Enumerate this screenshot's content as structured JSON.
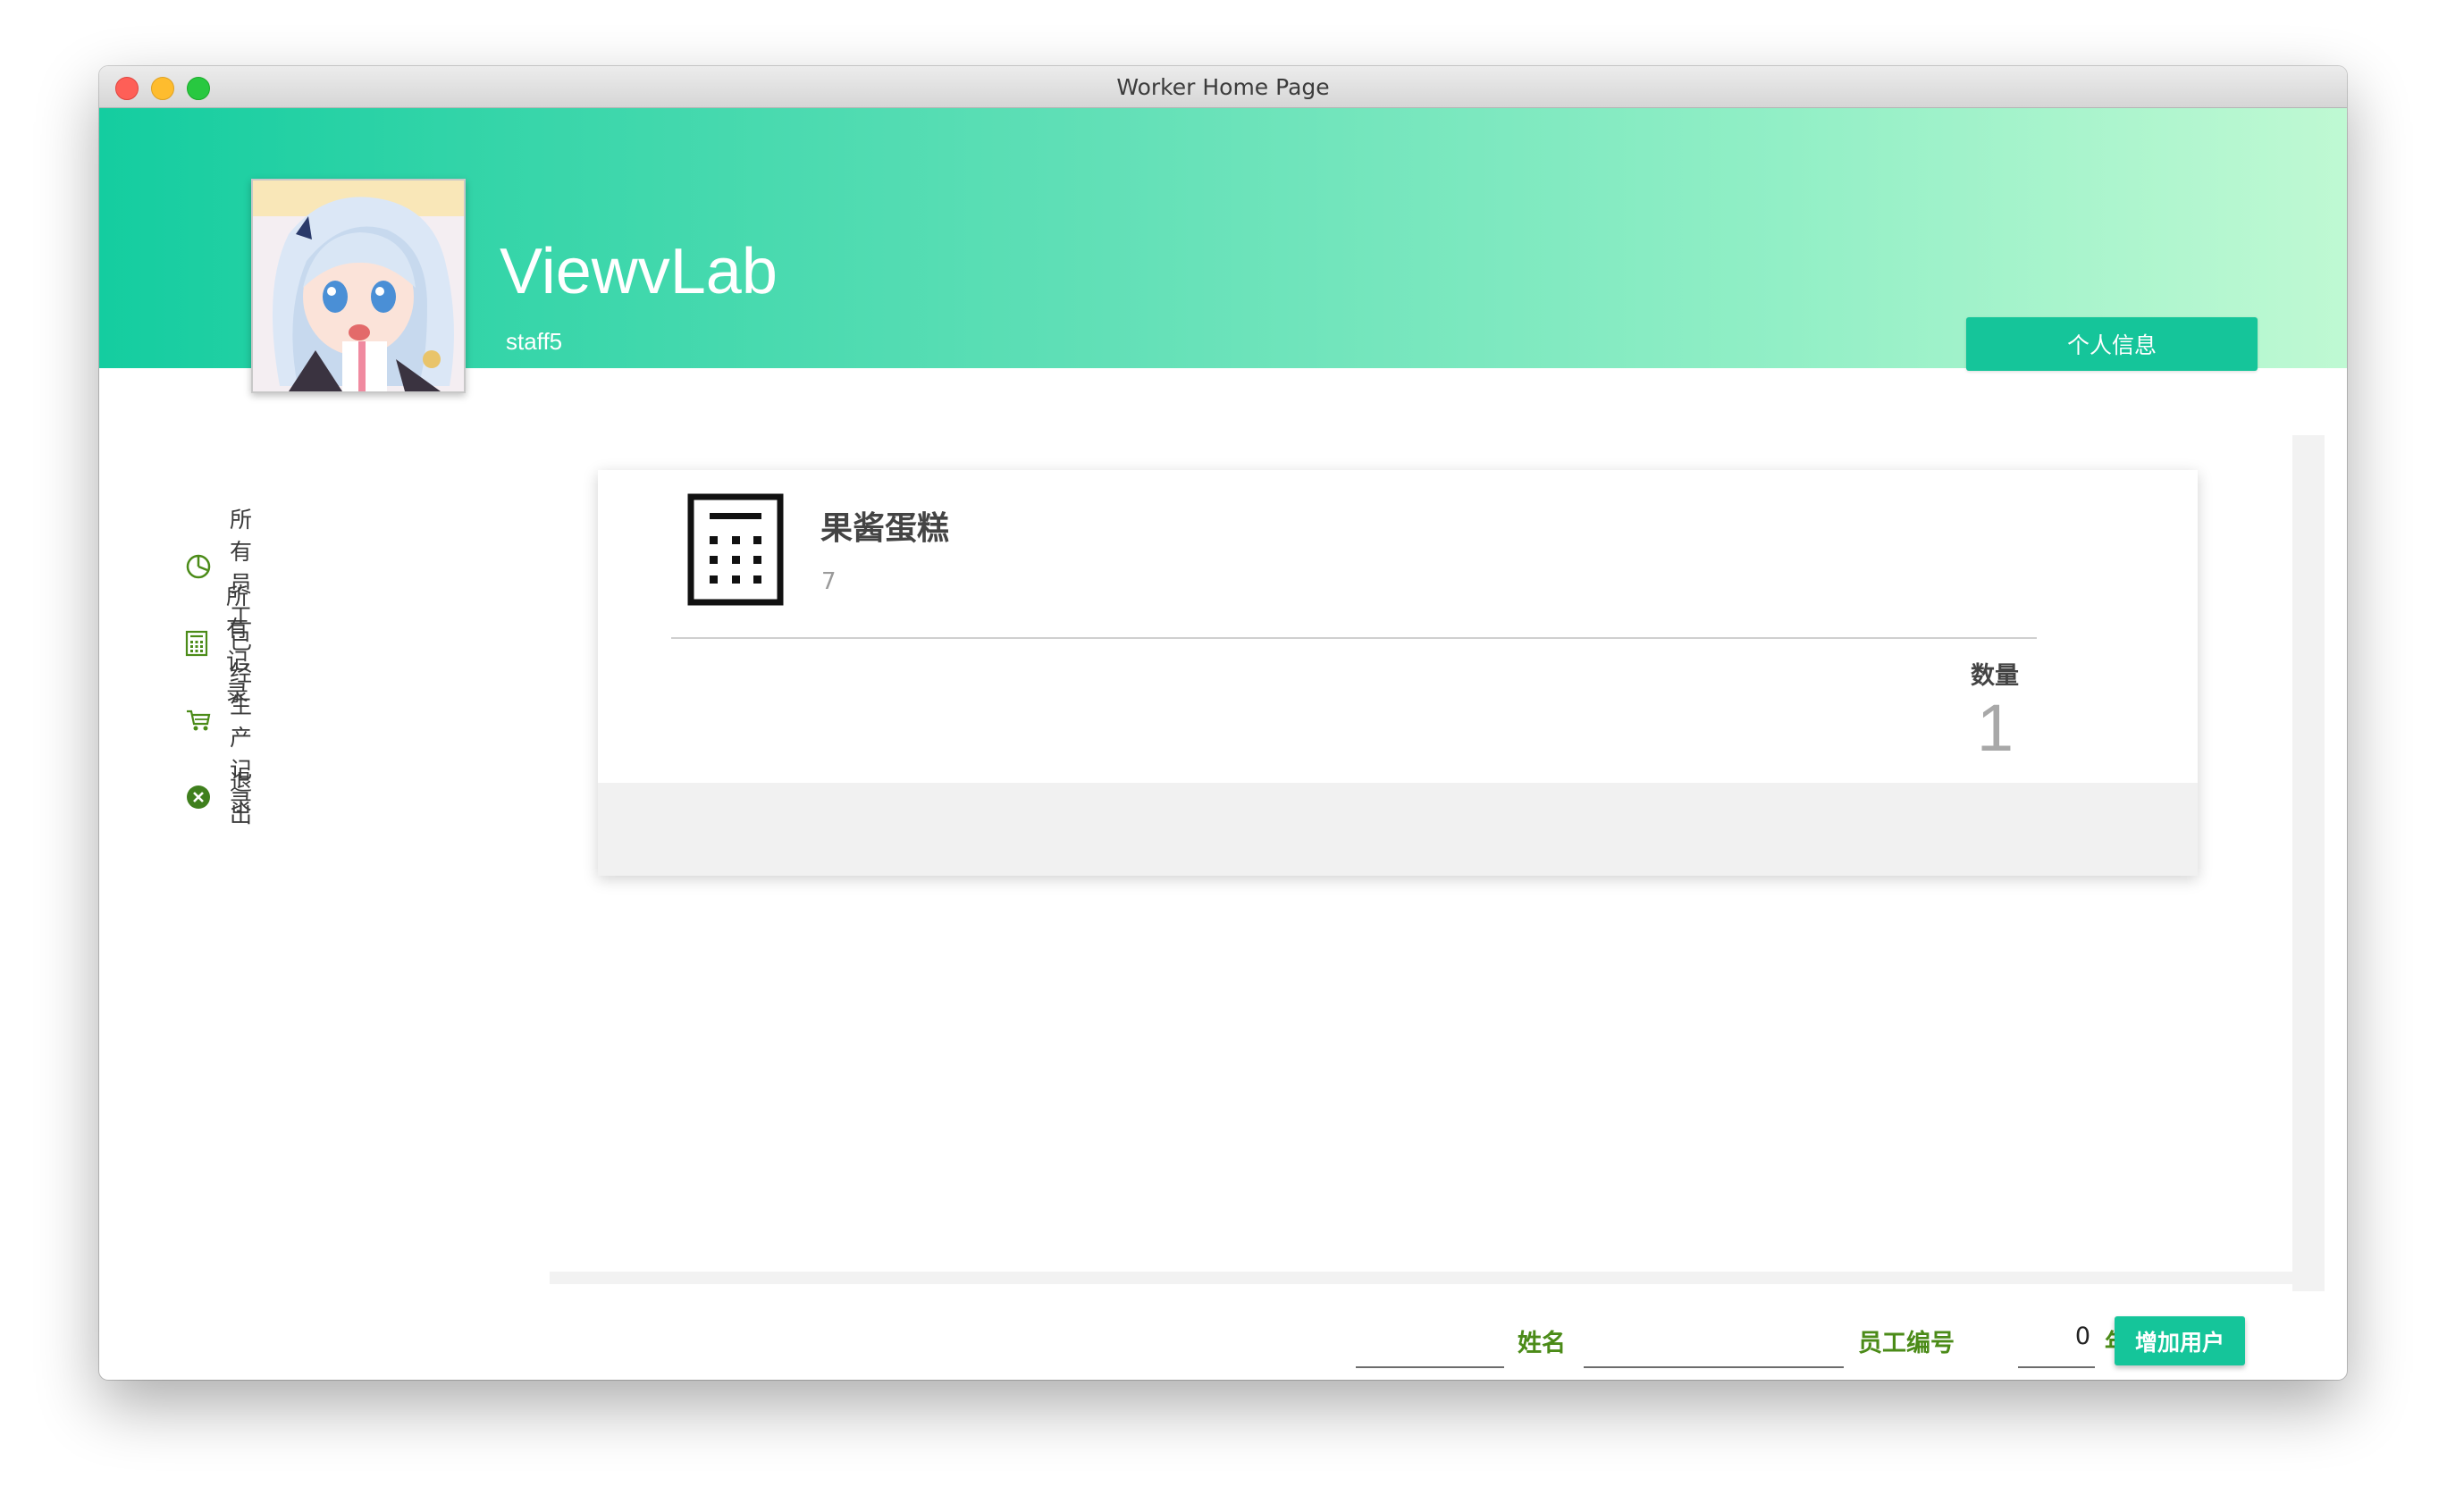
{
  "window": {
    "title": "Worker Home Page"
  },
  "header": {
    "brand": "ViewvLab",
    "username": "staff5",
    "profile_button": "个人信息"
  },
  "sidebar": {
    "items": [
      {
        "label": "所有员工",
        "icon": "pie-chart-icon"
      },
      {
        "label": "所有记录",
        "icon": "calculator-icon"
      },
      {
        "label": "已经生产记录",
        "icon": "cart-icon"
      },
      {
        "label": "退出",
        "icon": "close-circle-icon"
      }
    ]
  },
  "card": {
    "title": "果酱蛋糕",
    "subtitle": "7",
    "quantity_label": "数量",
    "quantity_value": "1"
  },
  "form": {
    "name_value": "",
    "name_label": "姓名",
    "employee_id_value": "",
    "employee_id_label": "员工编号",
    "age_value": "0",
    "age_label": "年龄",
    "add_button": "增加用户"
  },
  "colors": {
    "accent": "#15c59a",
    "label_green": "#4b8b18",
    "header_start": "#14cda0",
    "header_end": "#bff9d3"
  }
}
